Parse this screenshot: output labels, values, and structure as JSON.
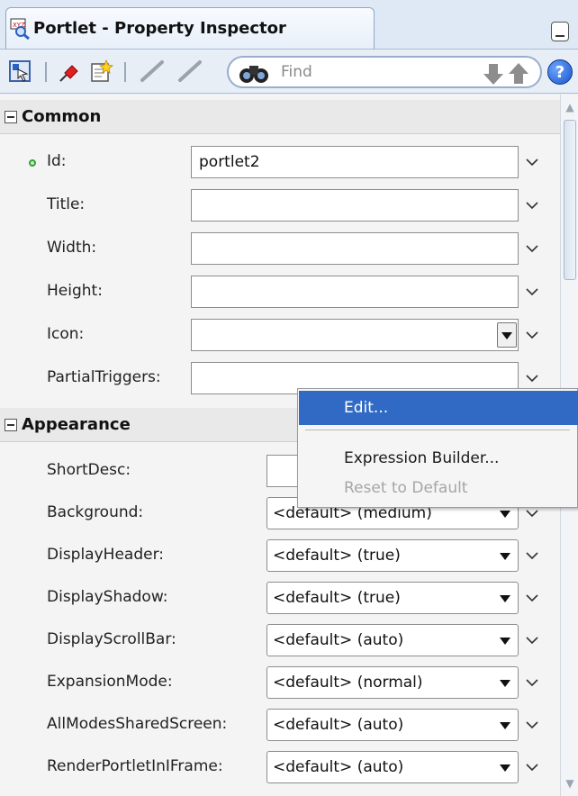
{
  "window": {
    "title": "Portlet - Property Inspector"
  },
  "toolbar": {
    "find_placeholder": "Find",
    "help_label": "?"
  },
  "sections": {
    "common": {
      "title": "Common",
      "rows": [
        {
          "label": "Id:",
          "value": "portlet2",
          "modified": true
        },
        {
          "label": "Title:",
          "value": ""
        },
        {
          "label": "Width:",
          "value": ""
        },
        {
          "label": "Height:",
          "value": ""
        },
        {
          "label": "Icon:",
          "value": ""
        },
        {
          "label": "PartialTriggers:",
          "value": ""
        }
      ]
    },
    "appearance": {
      "title": "Appearance",
      "rows": [
        {
          "label": "ShortDesc:",
          "value": ""
        },
        {
          "label": "Background:",
          "value": "<default> (medium)"
        },
        {
          "label": "DisplayHeader:",
          "value": "<default> (true)"
        },
        {
          "label": "DisplayShadow:",
          "value": "<default> (true)"
        },
        {
          "label": "DisplayScrollBar:",
          "value": "<default> (auto)"
        },
        {
          "label": "ExpansionMode:",
          "value": "<default> (normal)"
        },
        {
          "label": "AllModesSharedScreen:",
          "value": "<default> (auto)"
        },
        {
          "label": "RenderPortletInIFrame:",
          "value": "<default> (auto)"
        }
      ]
    }
  },
  "context_menu": {
    "items": [
      {
        "label": "Edit...",
        "state": "selected"
      },
      {
        "label": "Expression Builder...",
        "state": "enabled"
      },
      {
        "label": "Reset to Default",
        "state": "disabled"
      }
    ]
  },
  "colors": {
    "selection": "#316ac5",
    "panel": "#f4f4f4",
    "accent_border": "#98aecb"
  }
}
